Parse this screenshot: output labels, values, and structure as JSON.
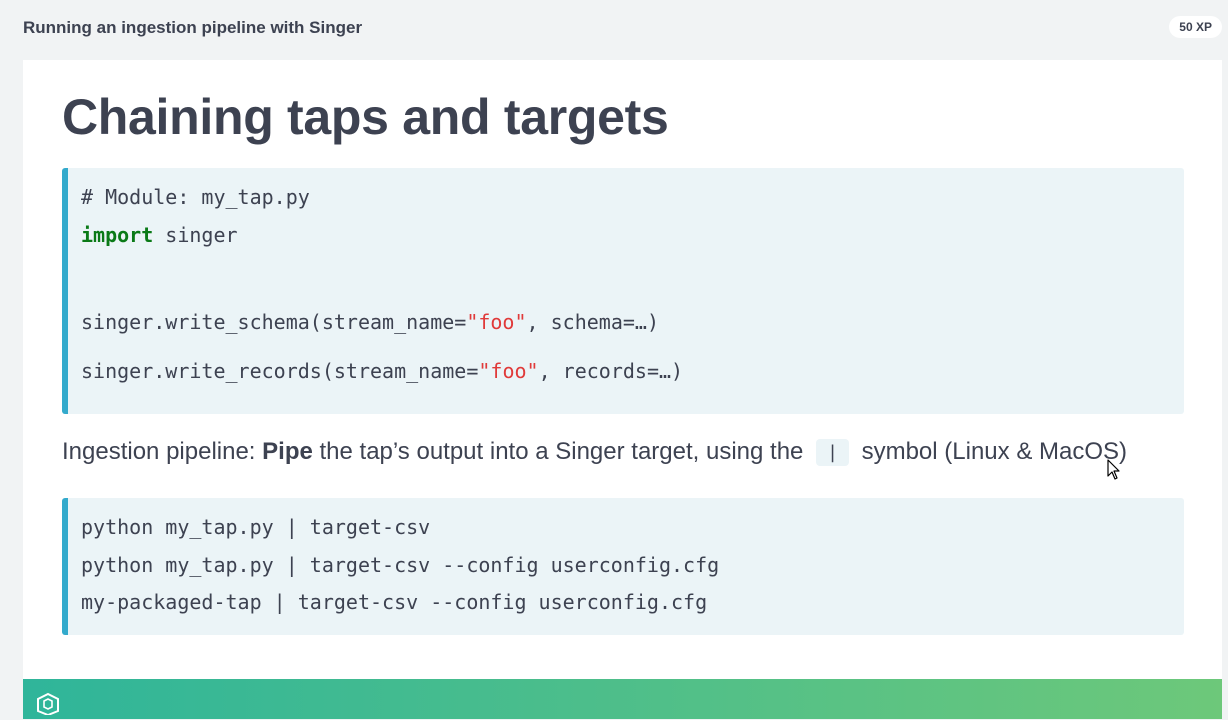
{
  "header": {
    "exercise_title": "Running an ingestion pipeline with Singer",
    "xp_badge": "50 XP"
  },
  "slide": {
    "title": "Chaining taps and targets",
    "code_block_1": {
      "comment": "# Module: my_tap.py",
      "import_kw": "import",
      "import_rest": " singer",
      "line3_pre": "singer.write_schema(stream_name=",
      "line3_str": "\"foo\"",
      "line3_post": ", schema=…)",
      "line4_pre": "singer.write_records(stream_name=",
      "line4_str": "\"foo\"",
      "line4_post": ", records=…)"
    },
    "paragraph": {
      "part1": "Ingestion pipeline: ",
      "bold": "Pipe",
      "part2": " the tap’s output into a Singer target, using the ",
      "chip": "|",
      "part3": " symbol (Linux & MacOS)"
    },
    "code_block_2": {
      "lines": [
        "python my_tap.py | target-csv",
        "python my_tap.py | target-csv --config userconfig.cfg",
        "my-packaged-tap | target-csv --config userconfig.cfg"
      ]
    }
  },
  "footer": {
    "logo_icon": "datacamp-logo-icon",
    "colors": {
      "start": "#2fb59a",
      "end": "#6dc87a"
    }
  },
  "colors": {
    "code_accent": "#33aacc",
    "code_bg": "#ebf4f7",
    "keyword": "#0a7a17",
    "string": "#e03a3a"
  }
}
